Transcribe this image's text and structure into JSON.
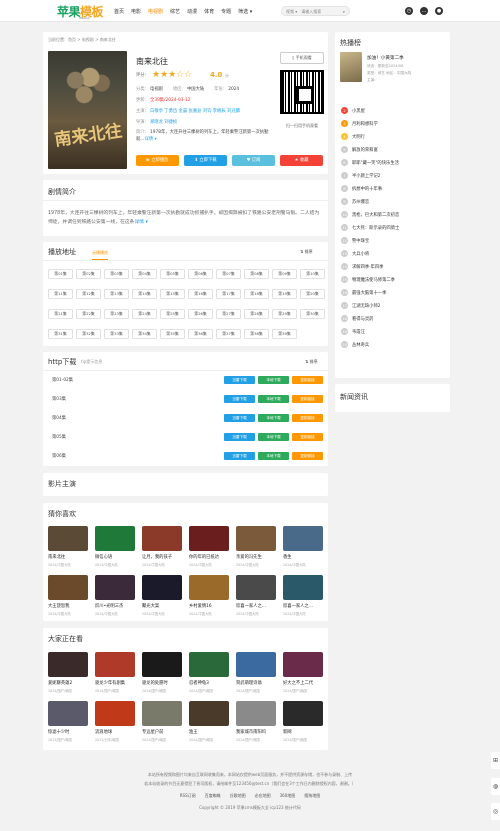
{
  "header": {
    "logo_main": "苹果",
    "logo_accent": "模板",
    "logo_sub": "PINGGUO",
    "nav": [
      "首页",
      "电影",
      "电视剧",
      "综艺",
      "动漫",
      "体育",
      "专题",
      "筛选 ▾"
    ],
    "search_type": "视频 ▾",
    "search_placeholder": "请输入搜索",
    "icons": [
      "history-icon",
      "message-icon",
      "user-icon"
    ]
  },
  "breadcrumb": {
    "prefix": "当前位置：",
    "home": "首页",
    "sep1": " > ",
    "cat": "电视剧",
    "sep2": " > ",
    "cur": "南来北往"
  },
  "movie": {
    "title": "南来北往",
    "rating_label": "评分:",
    "stars": "★★★☆☆",
    "score": "4.0",
    "score_unit": "分",
    "category_label": "分类:",
    "category": "电视剧",
    "region_label": "地区:",
    "region": "中国大陆",
    "year_label": "年份:",
    "year": "2024",
    "update_label": "更新:",
    "update": "全39集/2024-03-12",
    "cast_label": "主演:",
    "cast": "白敬亭 丁勇岱 金晨 张嘉益 刘钧 李柄辰 刘冠麟",
    "director_label": "导演:",
    "director": "郑晓龙 刘捷桢",
    "plot_label": "简介:",
    "plot": "1978年，大连开往三棵树的列车上，年轻乘警汪新第一次执勤就…",
    "plot_more": "详情 ▾",
    "poster_text": "南来北往",
    "phone_btn": "手机观看",
    "qr_text": "扫一扫用手机观看",
    "buttons": [
      {
        "label": "▶ 立即播放",
        "color": "#ff9800"
      },
      {
        "label": "⬇ 立即下载",
        "color": "#21a0e6"
      },
      {
        "label": "♥ 订阅",
        "color": "#5bc0de"
      },
      {
        "label": "★ 收藏",
        "color": "#f44336"
      }
    ]
  },
  "plot_section": {
    "title": "剧情简介",
    "text": "1978年，大连开往三棵树的列车上，年轻乘警汪新第一次执勤就成功抓捕扒手。却因揭弊被扣了铁路公安老刑警马魁。二人结为师徒，并调任到铁路公安第一线，在这条",
    "more": "详情 ▾"
  },
  "play_section": {
    "title": "播放地址",
    "source": "云播播放",
    "sort": "排序",
    "episodes": [
      "第01集",
      "第02集",
      "第03集",
      "第04集",
      "第05集",
      "第06集",
      "第07集",
      "第08集",
      "第09集",
      "第10集",
      "第11集",
      "第12集",
      "第13集",
      "第14集",
      "第15集",
      "第16集",
      "第17集",
      "第18集",
      "第19集",
      "第20集",
      "第21集",
      "第22集",
      "第23集",
      "第24集",
      "第25集",
      "第26集",
      "第27集",
      "第28集",
      "第29集",
      "第30集",
      "第31集",
      "第32集",
      "第33集",
      "第34集",
      "第35集",
      "第36集",
      "第37集",
      "第38集",
      "第39集"
    ]
  },
  "download_section": {
    "title": "http下载",
    "subtitle": "tip提示信息",
    "sort": "排序",
    "rows": [
      "第01-02集",
      "第03集",
      "第04集",
      "第05集",
      "第06集"
    ],
    "btn_copy": "迅雷下载",
    "btn_local": "本地下载",
    "btn_copyaddr": "复制链接"
  },
  "actors_section": {
    "title": "影片主演"
  },
  "guess_section": {
    "title": "猜你喜欢",
    "items": [
      {
        "name": "南来北往",
        "meta": "2024/中国大陆",
        "color": "#5a4a36"
      },
      {
        "name": "微信心语",
        "meta": "2024/中国大陆",
        "color": "#1f7a3a"
      },
      {
        "name": "让月，我的孩子",
        "meta": "2024/中国大陆",
        "color": "#8b3a2a"
      },
      {
        "name": "你的年的已抵达",
        "meta": "2024/中国大陆",
        "color": "#6b1e1e"
      },
      {
        "name": "亲爱的冯先生",
        "meta": "2024/中国大陆",
        "color": "#7a5a3a"
      },
      {
        "name": "香生",
        "meta": "2024/中国大陆",
        "color": "#4a6a8a"
      },
      {
        "name": "大王饶恕我",
        "meta": "2024/中国大陆",
        "color": "#6a4a2a"
      },
      {
        "name": "炽川•光明三杰",
        "meta": "2024/中国大陆",
        "color": "#3a2a3a"
      },
      {
        "name": "聚光大案",
        "meta": "2024/中国大陆",
        "color": "#1a1a2a"
      },
      {
        "name": "乡村爱情16",
        "meta": "2024/中国大陆",
        "color": "#9a6a2a"
      },
      {
        "name": "欣喜一家人之…",
        "meta": "2024/中国大陆",
        "color": "#4a4a4a"
      },
      {
        "name": "欣喜一家人之…",
        "meta": "2024/中国大陆",
        "color": "#2a5a6a"
      }
    ]
  },
  "everyone_section": {
    "title": "大家正在看",
    "items": [
      {
        "name": "爱妮聊英雄2",
        "meta": "2024/国产/韩国",
        "color": "#3a2a2a"
      },
      {
        "name": "驱龙少年有剧集",
        "meta": "2024/国产/韩国",
        "color": "#b03a2a"
      },
      {
        "name": "驱龙的处愿时",
        "meta": "2024/国产/韩国",
        "color": "#1a1a1a"
      },
      {
        "name": "忍者神龟3",
        "meta": "2024/国产/韩国",
        "color": "#2a6a3a"
      },
      {
        "name": "贺武萌理诗翁",
        "meta": "2024/国产/韩国",
        "color": "#3a6aa0"
      },
      {
        "name": "好大之不上二代",
        "meta": "2024/国产/韩国",
        "color": "#6a2a4a"
      },
      {
        "name": "惊滤十少时",
        "meta": "2023/国产/韩国",
        "color": "#5a5a6a"
      },
      {
        "name": "流浪地球",
        "meta": "2023/日本/韩国",
        "color": "#c03a1a"
      },
      {
        "name": "专远星户前",
        "meta": "2024/国产/韩国",
        "color": "#7a7a6a"
      },
      {
        "name": "渔王",
        "meta": "2024/国产/韩国",
        "color": "#4a3a2a"
      },
      {
        "name": "我家城市南阳坞",
        "meta": "2024/国产/韩国",
        "color": "#8a8a8a"
      },
      {
        "name": "新网",
        "meta": "2024/国产/韩国",
        "color": "#2a2a2a"
      }
    ]
  },
  "hot_section": {
    "title": "热播榜",
    "top_name": "加油！小黄第二季",
    "top_meta1": "状态：更新至2024/08",
    "top_meta2": "类型：综艺  地区：中国大陆",
    "top_meta3": "主演：",
    "items": [
      "小黑屋",
      "月利和想科学",
      "大明行",
      "解放的荣和富",
      "耶耶\"藏一笑\"的快乐生活",
      "半小颜上学记2",
      "拆想中的十年事",
      "苏州爆恋",
      "黑枪，巴大和第二次初恋",
      "七大死：斯示录的四骑士",
      "警中珠宝",
      "大兵小将",
      "求解四季·年四季",
      "物理魔法使马修第二季",
      "最强大脑第十一季",
      "江湖无缺小师2",
      "看得与灵药",
      "韦霞汪",
      "丛林奇兵"
    ],
    "colors": [
      "#f44336",
      "#ff9800",
      "#fbc02d"
    ]
  },
  "news_section": {
    "title": "新闻资讯"
  },
  "footer": {
    "line1": "本站所有视频和图片均来自互联网收集而来，本网站仅提供web页面服务，并不提供资源存储，也不参与录制、上传",
    "line2": "若本站收录的节目无意侵犯了贵司版权，请给邮件至123456@test.cn（我们会在3个工作日内删除侵权内容，谢谢。）",
    "links": [
      "RSS订阅",
      "百度蜘蛛",
      "谷歌地图",
      "必应地图",
      "360地图",
      "搜狗地图"
    ],
    "copyright": "Copyright © 2019 苹果cms模板大全 icp123 统计代码"
  }
}
